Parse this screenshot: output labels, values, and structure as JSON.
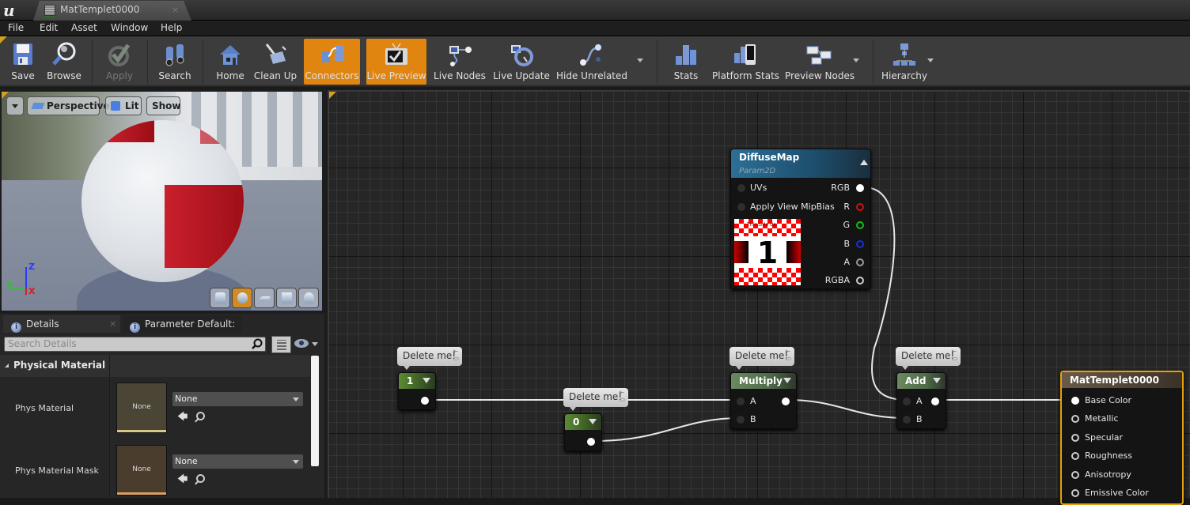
{
  "window": {
    "app_logo": "ue-logo",
    "tab_title": "MatTemplet0000",
    "tab_close": "×"
  },
  "menu": [
    "File",
    "Edit",
    "Asset",
    "Window",
    "Help"
  ],
  "toolbar": {
    "buttons": [
      {
        "label": "Save",
        "icon": "save-icon",
        "state": "normal"
      },
      {
        "label": "Browse",
        "icon": "browse-icon",
        "state": "normal"
      },
      {
        "label": "Apply",
        "icon": "apply-icon",
        "state": "disabled"
      },
      {
        "label": "Search",
        "icon": "binoculars-icon",
        "state": "normal"
      },
      {
        "label": "Home",
        "icon": "home-icon",
        "state": "normal"
      },
      {
        "label": "Clean Up",
        "icon": "broom-icon",
        "state": "normal"
      },
      {
        "label": "Connectors",
        "icon": "connectors-icon",
        "state": "active"
      },
      {
        "label": "Live Preview",
        "icon": "tv-icon",
        "state": "active"
      },
      {
        "label": "Live Nodes",
        "icon": "live-nodes-icon",
        "state": "normal"
      },
      {
        "label": "Live Update",
        "icon": "live-update-icon",
        "state": "normal"
      },
      {
        "label": "Hide Unrelated",
        "icon": "hide-unrelated-icon",
        "state": "normal"
      },
      {
        "label": "Stats",
        "icon": "stats-icon",
        "state": "normal"
      },
      {
        "label": "Platform Stats",
        "icon": "platform-stats-icon",
        "state": "normal"
      },
      {
        "label": "Preview Nodes",
        "icon": "preview-nodes-icon",
        "state": "normal"
      },
      {
        "label": "Hierarchy",
        "icon": "hierarchy-icon",
        "state": "normal"
      }
    ]
  },
  "viewport": {
    "options_menu": "▾",
    "view_mode": "Perspective",
    "lighting_mode": "Lit",
    "show_label": "Show",
    "axis": {
      "z": "Z",
      "y": "Y",
      "x": "X"
    },
    "preview_shapes": [
      "cylinder",
      "sphere",
      "plane",
      "cube",
      "teapot"
    ],
    "active_shape": "sphere"
  },
  "details": {
    "tabs": [
      {
        "label": "Details",
        "active": true
      },
      {
        "label": "Parameter Default:",
        "active": false
      }
    ],
    "search_placeholder": "Search Details",
    "category": "Physical Material",
    "properties": [
      {
        "label": "Phys Material",
        "thumbnail_text": "None",
        "value": "None"
      },
      {
        "label": "Phys Material Mask",
        "thumbnail_text": "None",
        "value": "None"
      }
    ]
  },
  "graph": {
    "nodes": {
      "diffuse": {
        "title": "DiffuseMap",
        "subtitle": "Param2D",
        "inputs": [
          "UVs",
          "Apply View MipBias"
        ],
        "outputs": [
          "RGB",
          "R",
          "G",
          "B",
          "A",
          "RGBA"
        ],
        "texture_number": "1",
        "texture_caption": "This Side Up"
      },
      "const1": {
        "title": "1",
        "comment": "Delete me!"
      },
      "const0": {
        "title": "0",
        "comment": "Delete me!"
      },
      "multiply": {
        "title": "Multiply",
        "inputs": [
          "A",
          "B"
        ],
        "comment": "Delete me!"
      },
      "add": {
        "title": "Add",
        "inputs": [
          "A",
          "B"
        ],
        "comment": "Delete me!"
      },
      "material": {
        "title": "MatTemplet0000",
        "inputs": [
          "Base Color",
          "Metallic",
          "Specular",
          "Roughness",
          "Anisotropy",
          "Emissive Color"
        ]
      }
    },
    "pin_colors": {
      "R": "#d01010",
      "G": "#12c012",
      "B": "#1030e0",
      "A": "#9a9a9a",
      "RGBA": "#cccccc"
    },
    "accent": "#e0850f",
    "selection": "#e5a00d"
  }
}
